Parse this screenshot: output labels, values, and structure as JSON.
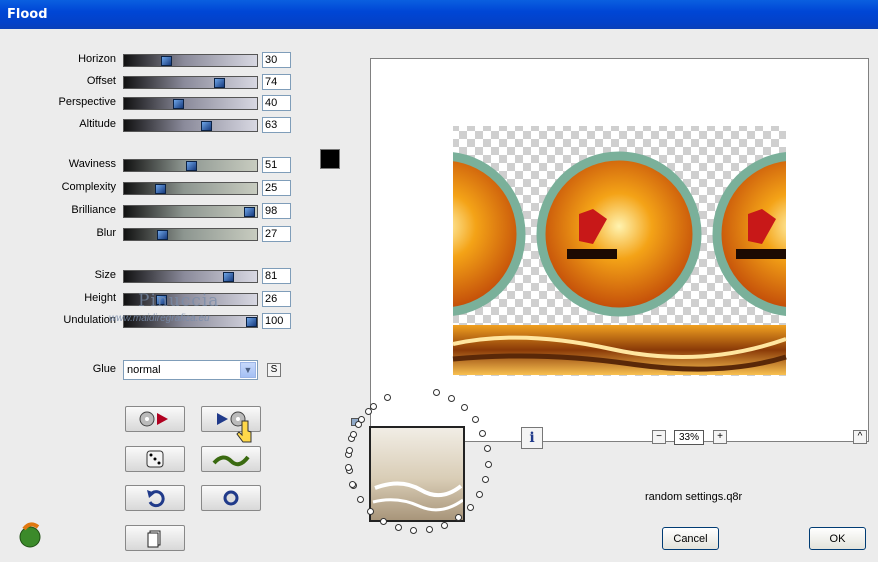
{
  "window": {
    "title": "Flood"
  },
  "sliders": [
    {
      "label": "Horizon",
      "value": "30",
      "level": 0.3
    },
    {
      "label": "Offset",
      "value": "74",
      "level": 0.74
    },
    {
      "label": "Perspective",
      "value": "40",
      "level": 0.4
    },
    {
      "label": "Altitude",
      "value": "63",
      "level": 0.63
    },
    {
      "label": "Waviness",
      "value": "51",
      "level": 0.51
    },
    {
      "label": "Complexity",
      "value": "25",
      "level": 0.25
    },
    {
      "label": "Brilliance",
      "value": "98",
      "level": 0.98
    },
    {
      "label": "Blur",
      "value": "27",
      "level": 0.27
    },
    {
      "label": "Size",
      "value": "81",
      "level": 0.81
    },
    {
      "label": "Height",
      "value": "26",
      "level": 0.26
    },
    {
      "label": "Undulation",
      "value": "100",
      "level": 1.0
    }
  ],
  "color_swatch": "#000000",
  "watermark": {
    "name": "Pinuccia",
    "site": "www.maidiregrafica.eu"
  },
  "glue": {
    "label": "Glue",
    "value": "normal",
    "s_button": "S"
  },
  "zoom": {
    "value": "33%",
    "minus": "−",
    "plus": "+"
  },
  "info_glyph": "i",
  "random_settings": "random settings.q8r",
  "caret_glyph": "^",
  "buttons": {
    "cancel": "Cancel",
    "ok": "OK"
  },
  "colors": {
    "titlebar": "#0046d5",
    "accent": "#d87a10"
  }
}
